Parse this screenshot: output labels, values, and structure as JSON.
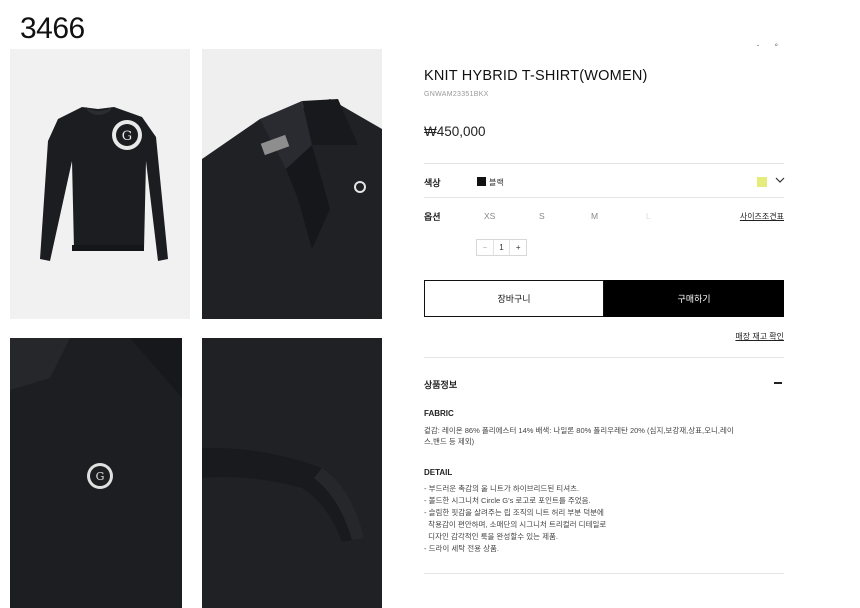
{
  "page_number": "3466",
  "top_icons": "· ◦",
  "product": {
    "title": "KNIT HYBRID T-SHIRT(WOMEN)",
    "code": "GNWAM23351BKX",
    "price": "₩450,000"
  },
  "color_option": {
    "label": "색상",
    "selected_name": "블랙",
    "swatch_color": "#111111",
    "alt_chip_color": "#e6ec7c"
  },
  "size_option": {
    "label": "옵션",
    "sizes": [
      "XS",
      "S",
      "M",
      "L"
    ],
    "guide_label": "사이즈조견표"
  },
  "quantity": {
    "minus": "−",
    "value": "1",
    "plus": "+"
  },
  "buttons": {
    "cart": "장바구니",
    "buy": "구매하기",
    "store_stock": "매장 재고 확인"
  },
  "details": {
    "title": "상품정보",
    "fabric_heading": "FABRIC",
    "fabric_lines": [
      "겉감: 레이온 86% 폴리에스터 14% 배색: 나일론 80% 폴리우레탄 20% (심지,보강재,상표,오니,레이",
      "스,밴드 등 제외)"
    ],
    "detail_heading": "DETAIL",
    "detail_lines": [
      "- 부드러운 촉감의 울 니트가 하이브리드된 티셔츠.",
      "- 볼드한 시그니처 Circle G's 로고로 포인트를 주었음.",
      "- 슬림한 핏감을 살려주는 립 조직의 니트 허리 부분 덕분에",
      "  착용감이 편안하며, 소매단의 시그니처 트리컬러 디테일로",
      "  디자인 감각적인 룩을 완성할수 있는 제품.",
      "- 드라이 세탁 전용 상품."
    ]
  }
}
